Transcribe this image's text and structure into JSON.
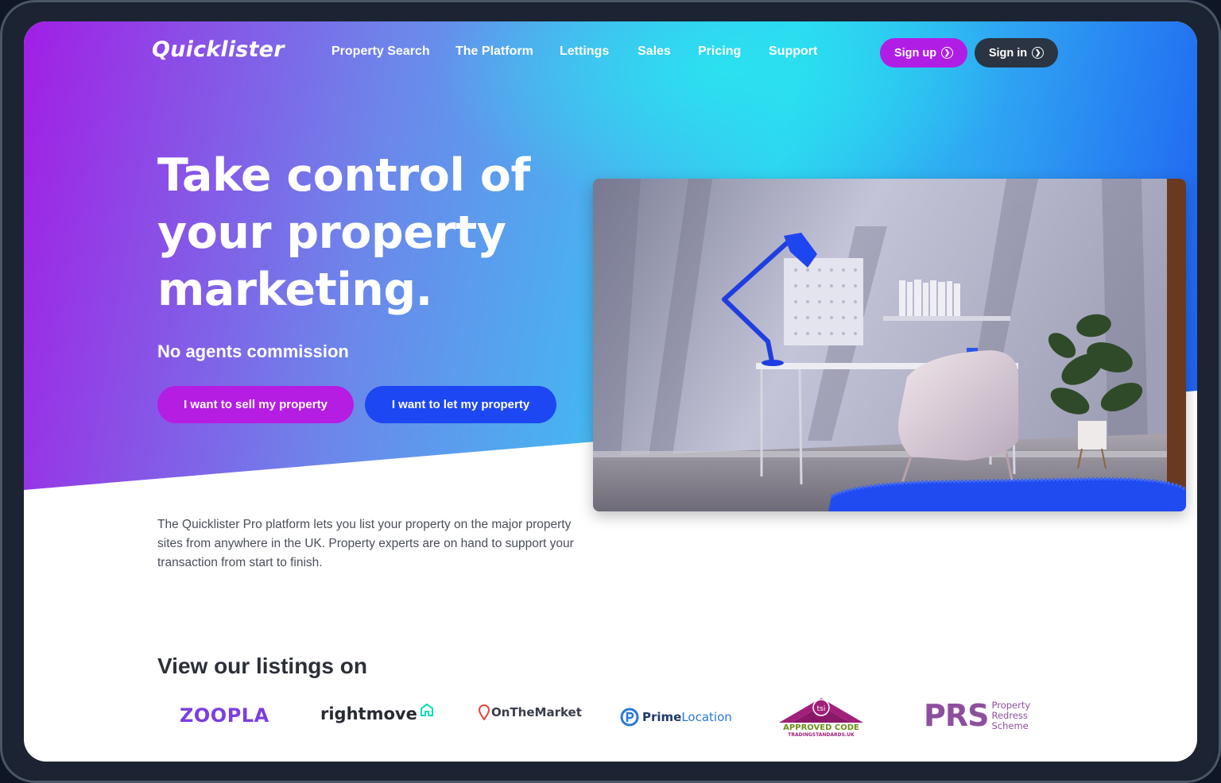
{
  "brand": {
    "name": "Quicklister"
  },
  "nav": {
    "links": [
      "Property Search",
      "The Platform",
      "Lettings",
      "Sales",
      "Pricing",
      "Support"
    ],
    "signup_label": "Sign up",
    "signin_label": "Sign in"
  },
  "hero": {
    "headline_line1": "Take control of",
    "headline_line2": "your property",
    "headline_line3": "marketing.",
    "subhead": "No agents commission",
    "sell_button": "I want to sell my property",
    "let_button": "I want to let my property"
  },
  "intro": {
    "text": "The Quicklister Pro platform lets you list your property on the major property sites from anywhere in the UK. Property experts are on hand to support your transaction from start to finish."
  },
  "listings": {
    "title": "View our listings on",
    "zoopla": "ZOOPLA",
    "rightmove": "rightmove",
    "onthemarket": "OnTheMarket",
    "primelocation_prime": "Prime",
    "primelocation_location": "Location",
    "tsi_badge": "tsi",
    "tsi_line1": "APPROVED CODE",
    "tsi_line2": "TRADINGSTANDARDS.UK",
    "prs_mark": "PRS",
    "prs_line1": "Property",
    "prs_line2": "Redress",
    "prs_line3": "Scheme"
  },
  "colors": {
    "accent_purple": "#b01ee6",
    "accent_blue": "#1d47f2",
    "dark_button": "#2b3442"
  }
}
